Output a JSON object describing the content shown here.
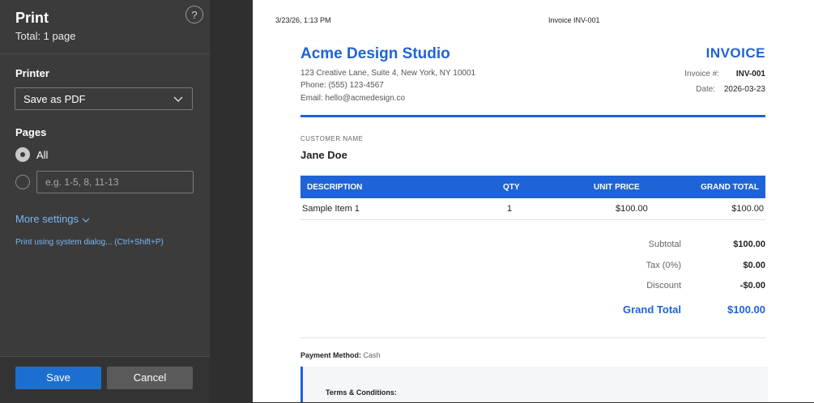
{
  "panel": {
    "title": "Print",
    "subtitle": "Total: 1 page",
    "help_glyph": "?",
    "printer_label": "Printer",
    "printer_value": "Save as PDF",
    "pages_label": "Pages",
    "pages_all_label": "All",
    "pages_range_placeholder": "e.g. 1-5, 8, 11-13",
    "more_settings": "More settings",
    "system_dialog": "Print using system dialog... (Ctrl+Shift+P)",
    "save_label": "Save",
    "cancel_label": "Cancel"
  },
  "preview": {
    "header_datetime": "3/23/26, 1:13 PM",
    "header_title": "Invoice INV-001",
    "company": "Acme Design Studio",
    "address": "123 Creative Lane, Suite 4, New York, NY 10001",
    "phone": "Phone: (555) 123-4567",
    "email": "Email: hello@acmedesign.co",
    "invoice_title": "INVOICE",
    "invoice_no_label": "Invoice #:",
    "invoice_no": "INV-001",
    "date_label": "Date:",
    "date": "2026-03-23",
    "customer_label": "CUSTOMER NAME",
    "customer_name": "Jane Doe",
    "table": {
      "headers": [
        "DESCRIPTION",
        "QTY",
        "UNIT PRICE",
        "GRAND TOTAL"
      ],
      "rows": [
        [
          "Sample Item 1",
          "1",
          "$100.00",
          "$100.00"
        ]
      ]
    },
    "totals": {
      "subtotal_label": "Subtotal",
      "subtotal": "$100.00",
      "tax_label": "Tax (0%)",
      "tax": "$0.00",
      "discount_label": "Discount",
      "discount": "-$0.00",
      "grand_label": "Grand Total",
      "grand": "$100.00"
    },
    "payment_label": "Payment Method:",
    "payment_value": "Cash",
    "terms_title": "Terms & Conditions:"
  },
  "colors": {
    "accent": "#1f63d8",
    "save_button": "#1c6fd1",
    "panel_bg": "#3b3b3b"
  }
}
